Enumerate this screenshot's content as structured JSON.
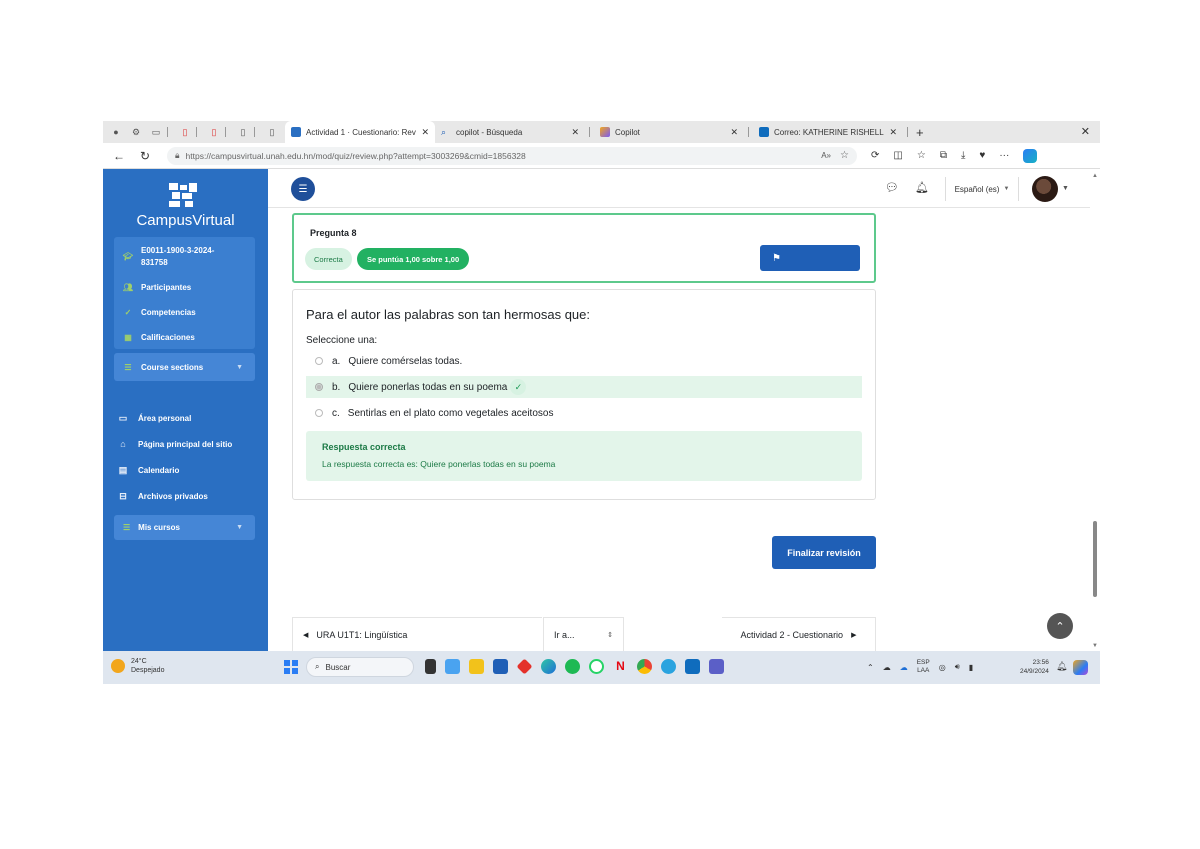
{
  "browser": {
    "tabs": [
      {
        "label": "Actividad 1 · Cuestionario: Revisi",
        "active": true,
        "favicon_color": "#2a6fc2"
      },
      {
        "label": "copilot - Búsqueda",
        "active": false,
        "favicon_color": "#1f5fb6"
      },
      {
        "label": "Copilot",
        "active": false,
        "favicon_color": "#7a5af5"
      },
      {
        "label": "Correo: KATHERINE RISHELL CORE",
        "active": false,
        "favicon_color": "#0f6cbd"
      }
    ],
    "url": "https://campusvirtual.unah.edu.hn/mod/quiz/review.php?attempt=3003269&cmid=1856328",
    "new_tab": "+",
    "close": "✕"
  },
  "sidebar": {
    "brand": "CampusVirtual",
    "course": "E0011-1900-3-2024-831758",
    "items": [
      {
        "label": "Participantes",
        "icon": "users-icon"
      },
      {
        "label": "Competencias",
        "icon": "check-icon"
      },
      {
        "label": "Calificaciones",
        "icon": "grades-icon"
      },
      {
        "label": "Course sections",
        "icon": "list-icon"
      }
    ],
    "nav": [
      {
        "label": "Área personal",
        "icon": "dashboard-icon"
      },
      {
        "label": "Página principal del sitio",
        "icon": "home-icon"
      },
      {
        "label": "Calendario",
        "icon": "calendar-icon"
      },
      {
        "label": "Archivos privados",
        "icon": "folder-icon"
      }
    ],
    "my_courses": "Mis cursos"
  },
  "header": {
    "language": "Español (es)"
  },
  "question": {
    "number": "Pregunta 8",
    "state": "Correcta",
    "grade": "Se puntúa 1,00 sobre 1,00",
    "text": "Para el autor las palabras son tan hermosas que:",
    "prompt": "Seleccione una:",
    "options": [
      {
        "letter": "a.",
        "text": "Quiere comérselas todas.",
        "correct": false
      },
      {
        "letter": "b.",
        "text": "Quiere ponerlas todas en su poema",
        "correct": true
      },
      {
        "letter": "c.",
        "text": "Sentirlas en el plato como vegetales aceitosos",
        "correct": false
      }
    ],
    "feedback_title": "Respuesta correcta",
    "feedback_text": "La respuesta correcta es: Quiere ponerlas todas en su poema"
  },
  "actions": {
    "finish": "Finalizar revisión"
  },
  "activity_nav": {
    "prev": "URA U1T1: Lingüística",
    "jump": "Ir a...",
    "next": "Actividad 2 - Cuestionario"
  },
  "taskbar": {
    "temperature": "24°C",
    "weather": "Despejado",
    "search_placeholder": "Buscar",
    "lang_top": "ESP",
    "lang_bottom": "LAA",
    "time": "23:56",
    "date": "24/9/2024"
  }
}
